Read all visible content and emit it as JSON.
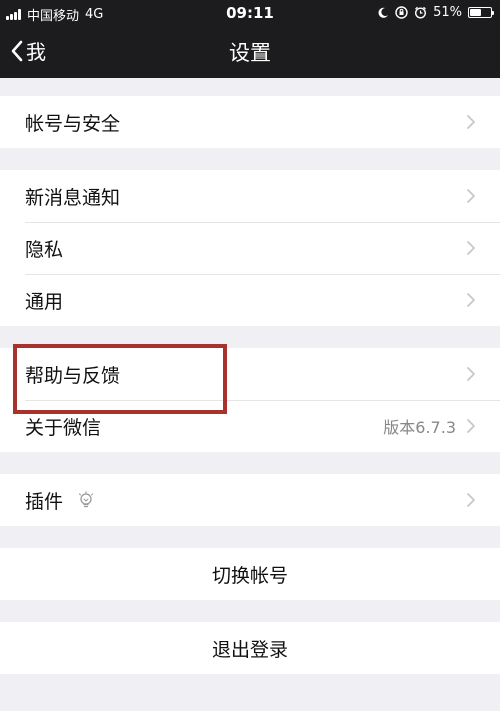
{
  "status": {
    "carrier": "中国移动",
    "network": "4G",
    "time": "09:11",
    "battery": "51%"
  },
  "nav": {
    "back_label": "我",
    "title": "设置"
  },
  "groups": [
    {
      "rows": [
        {
          "label": "帐号与安全"
        }
      ]
    },
    {
      "rows": [
        {
          "label": "新消息通知"
        },
        {
          "label": "隐私"
        },
        {
          "label": "通用"
        }
      ]
    },
    {
      "rows": [
        {
          "label": "帮助与反馈"
        },
        {
          "label": "关于微信",
          "value": "版本6.7.3"
        }
      ]
    },
    {
      "rows": [
        {
          "label": "插件"
        }
      ]
    }
  ],
  "actions": {
    "switch_account": "切换帐号",
    "logout": "退出登录"
  },
  "colors": {
    "nav_bg": "#1c1c1e",
    "page_bg": "#efeff4",
    "highlight_box": "#a8322c"
  }
}
